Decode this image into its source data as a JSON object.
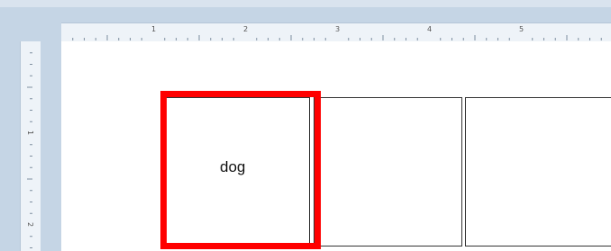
{
  "ruler": {
    "horizontal_numbers": [
      "1",
      "2",
      "3",
      "4",
      "5"
    ],
    "vertical_numbers": [
      "1",
      "2"
    ]
  },
  "cells": [
    {
      "text": "dog",
      "selected": true
    },
    {
      "text": "",
      "selected": false
    },
    {
      "text": "",
      "selected": false
    }
  ],
  "colors": {
    "selection": "#ff0000",
    "ruler_background": "#c5d5e5",
    "ruler_face": "#eef3f8"
  }
}
